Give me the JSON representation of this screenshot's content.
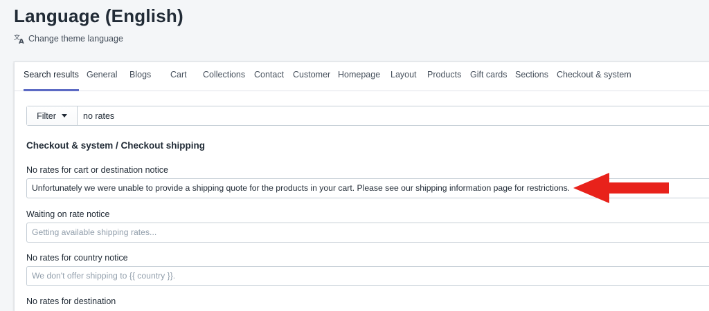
{
  "header": {
    "title": "Language (English)",
    "change_language_label": "Change theme language"
  },
  "tabs": [
    {
      "label": "Search results",
      "active": true
    },
    {
      "label": "General"
    },
    {
      "label": "Blogs"
    },
    {
      "label": "Cart"
    },
    {
      "label": "Collections"
    },
    {
      "label": "Contact"
    },
    {
      "label": "Customer"
    },
    {
      "label": "Homepage"
    },
    {
      "label": "Layout"
    },
    {
      "label": "Products"
    },
    {
      "label": "Gift cards"
    },
    {
      "label": "Sections"
    },
    {
      "label": "Checkout & system"
    }
  ],
  "filter": {
    "button_label": "Filter",
    "query": "no rates"
  },
  "section": {
    "title": "Checkout & system / Checkout shipping"
  },
  "fields": [
    {
      "label": "No rates for cart or destination notice",
      "value": "Unfortunately we were unable to provide a shipping quote for the products in your cart. Please see our shipping information page for restrictions."
    },
    {
      "label": "Waiting on rate notice",
      "placeholder": "Getting available shipping rates..."
    },
    {
      "label": "No rates for country notice",
      "placeholder": "We don't offer shipping to {{ country }}."
    },
    {
      "label": "No rates for destination"
    }
  ],
  "colors": {
    "accent": "#5c6ac4",
    "annotation_arrow": "#e8221b"
  },
  "icons": {
    "change_language": "translate-icon",
    "filter_caret": "caret-down-icon",
    "annotation": "red-arrow-left"
  }
}
